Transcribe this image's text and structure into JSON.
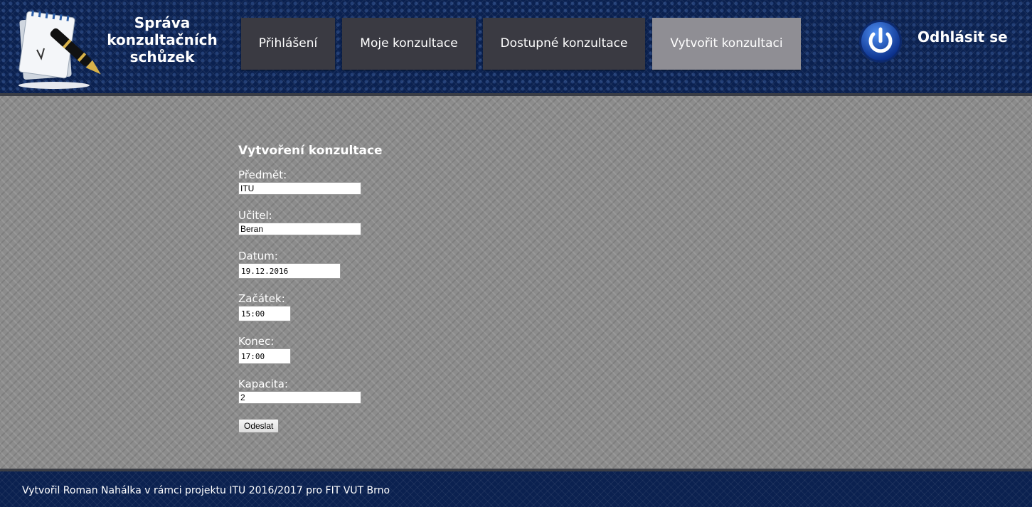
{
  "header": {
    "site_title": [
      "Správa",
      "konzultačních",
      "schůzek"
    ],
    "nav": [
      {
        "label": "Přihlášení",
        "active": false
      },
      {
        "label": "Moje konzultace",
        "active": false
      },
      {
        "label": "Dostupné konzultace",
        "active": false
      },
      {
        "label": "Vytvořit konzultaci",
        "active": true
      }
    ],
    "logout_label": "Odhlásit se",
    "logout_icon": "power-icon",
    "logo_icon": "notepad-pen-icon"
  },
  "form": {
    "title": "Vytvoření konzultace",
    "fields": [
      {
        "label": "Předmět:",
        "value": "ITU"
      },
      {
        "label": "Učitel:",
        "value": "Beran"
      },
      {
        "label": "Datum:",
        "value": "19.12.2016"
      },
      {
        "label": "Začátek:",
        "value": "15:00"
      },
      {
        "label": "Konec:",
        "value": "17:00"
      },
      {
        "label": "Kapacita:",
        "value": "2"
      }
    ],
    "submit_label": "Odeslat"
  },
  "footer": {
    "text": "Vytvořil Roman Nahálka v rámci projektu ITU 2016/2017 pro FIT VUT Brno"
  },
  "colors": {
    "header_bg": "#0b2150",
    "nav_bg": "#3a3a42",
    "nav_active_bg": "#8f8e94",
    "main_bg": "#8c8c8c"
  }
}
